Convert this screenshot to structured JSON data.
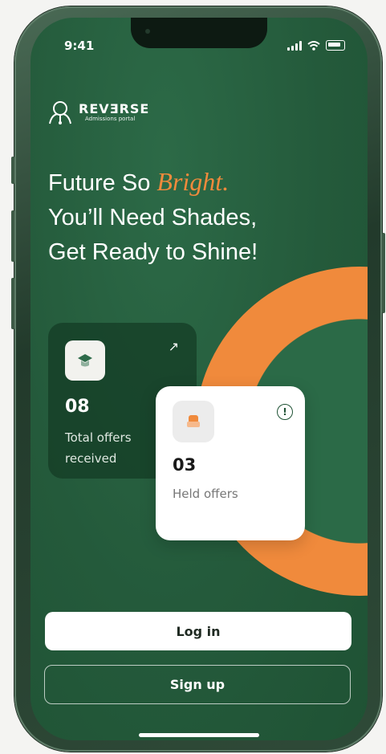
{
  "status_bar": {
    "time": "9:41"
  },
  "brand": {
    "name": "REVƎRSE",
    "tagline": "Admissions portal"
  },
  "headline": {
    "line1_prefix": "Future So ",
    "line1_accent": "Bright.",
    "line2": "You’ll Need Shades,",
    "line3": "Get Ready to Shine!"
  },
  "stats": {
    "total": {
      "value": "08",
      "label": "Total offers received"
    },
    "held": {
      "value": "03",
      "label": "Held offers"
    }
  },
  "actions": {
    "login_label": "Log in",
    "signup_label": "Sign up"
  },
  "colors": {
    "background": "#245a3b",
    "accent": "#f08a3c",
    "card_light": "#ffffff"
  },
  "icons": [
    "graduation-cap-icon",
    "arrow-up-right-icon",
    "chair-icon",
    "info-icon",
    "signal-icon",
    "wifi-icon",
    "battery-icon"
  ]
}
